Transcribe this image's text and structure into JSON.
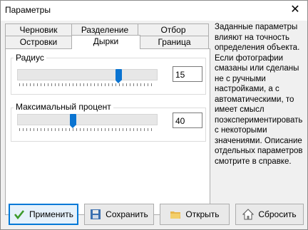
{
  "window": {
    "title": "Параметры"
  },
  "tabs": {
    "row1": [
      "Черновик",
      "Разделение",
      "Отбор"
    ],
    "row2": [
      "Островки",
      "Дырки",
      "Граница"
    ],
    "active": "Дырки"
  },
  "radius": {
    "label": "Радиус",
    "value": "15",
    "slider_fraction": 0.74
  },
  "max_percent": {
    "label": "Максимальный процент",
    "value": "40",
    "slider_fraction": 0.4
  },
  "help_text": "Заданные параметры влияют на точность определения объекта. Если фотографии смазаны или сделаны не с ручными настройками, а с автоматическими, то имеет смысл поэкспериментировать с некоторыми значениями. Описание отдельных параметров смотрите в справке.",
  "buttons": {
    "apply": "Применить",
    "save": "Сохранить",
    "open": "Открыть",
    "reset": "Сбросить"
  },
  "icons": {
    "apply": "checkmark-icon",
    "save": "floppy-icon",
    "open": "folder-icon",
    "reset": "home-icon"
  },
  "colors": {
    "accent": "#0078d7",
    "thumb": "#0b74d1"
  }
}
